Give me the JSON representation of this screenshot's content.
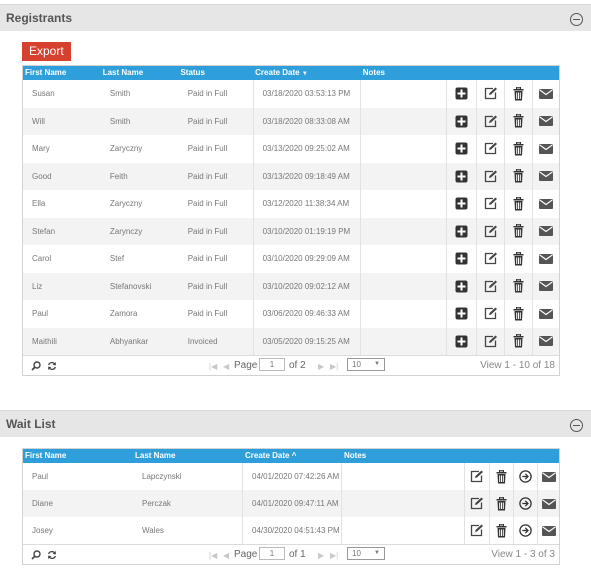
{
  "registrants": {
    "title": "Registrants",
    "export_label": "Export",
    "columns": [
      "First Name",
      "Last Name",
      "Status",
      "Create Date",
      "Notes"
    ],
    "sort_indicator": "▼",
    "rows": [
      {
        "first": "Susan",
        "last": "Smith",
        "status": "Paid in Full",
        "date": "03/18/2020 03:53:13 PM"
      },
      {
        "first": "Will",
        "last": "Smith",
        "status": "Paid in Full",
        "date": "03/18/2020 08:33:08 AM"
      },
      {
        "first": "Mary",
        "last": "Zaryczny",
        "status": "Paid in Full",
        "date": "03/13/2020 09:25:02 AM"
      },
      {
        "first": "Good",
        "last": "Feith",
        "status": "Paid in Full",
        "date": "03/13/2020 09:18:49 AM"
      },
      {
        "first": "Ella",
        "last": "Zaryczny",
        "status": "Paid in Full",
        "date": "03/12/2020 11:38:34 AM"
      },
      {
        "first": "Stefan",
        "last": "Zarynczy",
        "status": "Paid in Full",
        "date": "03/10/2020 01:19:19 PM"
      },
      {
        "first": "Carol",
        "last": "Stef",
        "status": "Paid in Full",
        "date": "03/10/2020 09:29:09 AM"
      },
      {
        "first": "Liz",
        "last": "Stefanovski",
        "status": "Paid in Full",
        "date": "03/10/2020 09:02:12 AM"
      },
      {
        "first": "Paul",
        "last": "Zamora",
        "status": "Paid in Full",
        "date": "03/06/2020 09:46:33 AM"
      },
      {
        "first": "Maithili",
        "last": "Abhyankar",
        "status": "Invoiced",
        "date": "03/05/2020 09:15:25 AM"
      }
    ],
    "pager": {
      "page_label": "Page",
      "page_value": "1",
      "of_label": "of 2",
      "rows_per_page": "10",
      "view_info": "View 1 - 10 of 18"
    }
  },
  "waitlist": {
    "title": "Wait List",
    "columns": [
      "First Name",
      "Last Name",
      "Create Date",
      "Notes"
    ],
    "sort_indicator": "^",
    "rows": [
      {
        "first": "Paul",
        "last": "Lapczynski",
        "date": "04/01/2020 07:42:26 AM"
      },
      {
        "first": "Diane",
        "last": "Perczak",
        "date": "04/01/2020 09:47:11 AM"
      },
      {
        "first": "Josey",
        "last": "Wales",
        "date": "04/30/2020 04:51:43 PM"
      }
    ],
    "pager": {
      "page_label": "Page",
      "page_value": "1",
      "of_label": "of 1",
      "rows_per_page": "10",
      "view_info": "View 1 - 3 of 3"
    }
  },
  "icons": {
    "add": "plus-square-icon",
    "edit": "edit-icon",
    "delete": "trash-icon",
    "email": "envelope-icon",
    "move": "arrow-circle-right-icon",
    "search": "search-icon",
    "refresh": "refresh-icon",
    "collapse": "minus-circle-icon"
  },
  "colors": {
    "header_blue": "#2e9fdb",
    "export_red": "#d6402e",
    "panel_gray": "#e6e6e6"
  }
}
